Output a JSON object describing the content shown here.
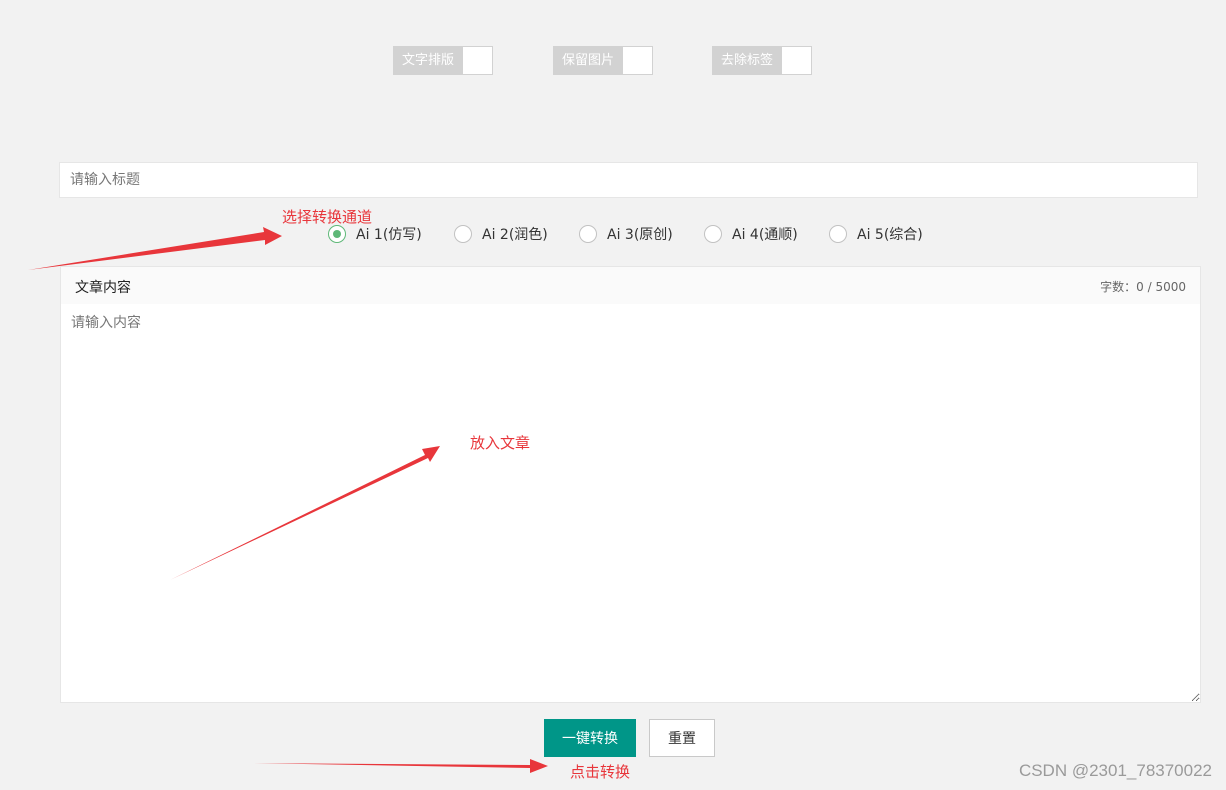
{
  "toggles": [
    {
      "label": "文字排版",
      "on": false
    },
    {
      "label": "保留图片",
      "on": false
    },
    {
      "label": "去除标签",
      "on": false
    }
  ],
  "title_input": {
    "placeholder": "请输入标题",
    "value": ""
  },
  "channels": [
    {
      "label": "Ai 1(仿写)",
      "selected": true
    },
    {
      "label": "Ai 2(润色)",
      "selected": false
    },
    {
      "label": "Ai 3(原创)",
      "selected": false
    },
    {
      "label": "Ai 4(通顺)",
      "selected": false
    },
    {
      "label": "Ai 5(综合)",
      "selected": false
    }
  ],
  "article": {
    "header": "文章内容",
    "count_label": "字数：0 / 5000",
    "placeholder": "请输入内容",
    "value": ""
  },
  "buttons": {
    "convert": "一键转换",
    "reset": "重置"
  },
  "annotations": {
    "select_channel": "选择转换通道",
    "put_article": "放入文章",
    "click_convert": "点击转换"
  },
  "watermark": "CSDN @2301_78370022",
  "colors": {
    "primary": "#009688",
    "radio_checked": "#5fb878",
    "toggle_off": "#d2d2d2",
    "annotation": "#e8363b",
    "background": "#f2f2f2"
  }
}
